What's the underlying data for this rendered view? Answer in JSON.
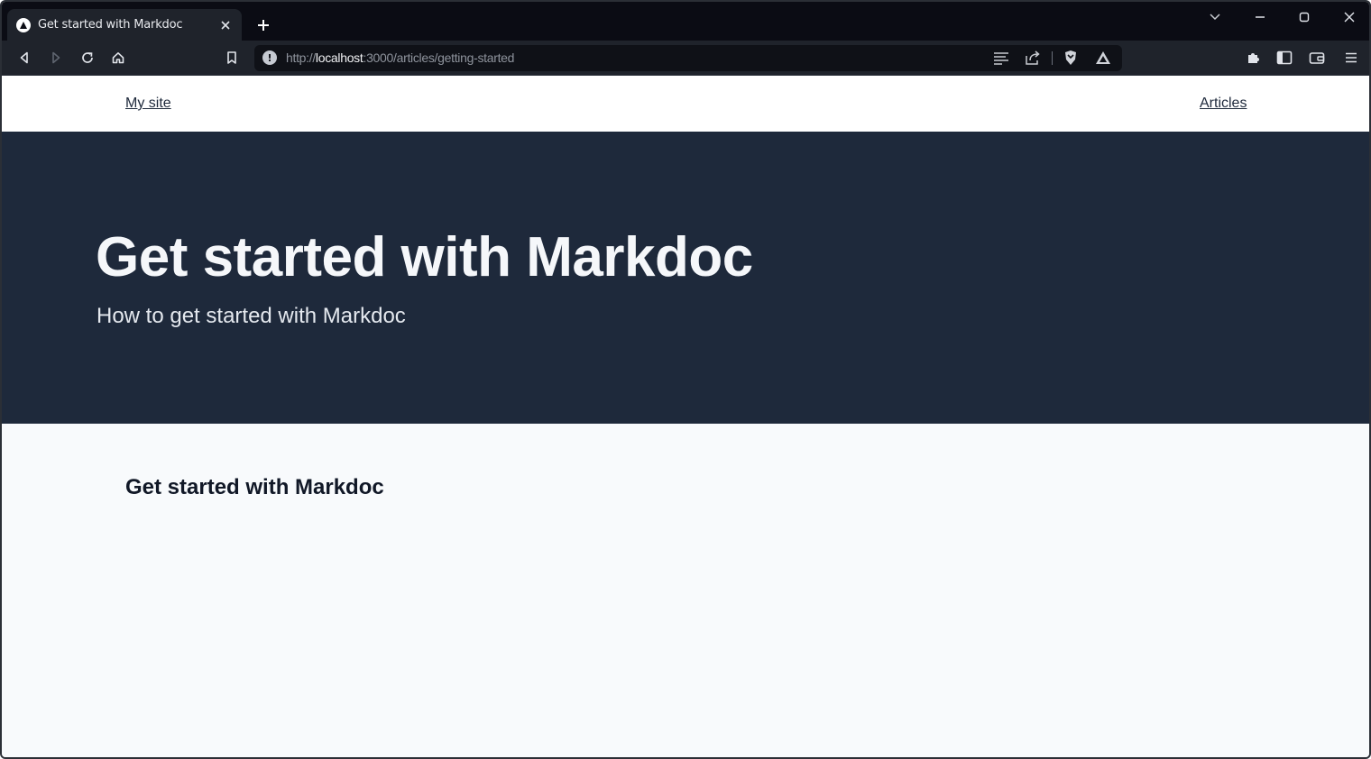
{
  "browser": {
    "tab": {
      "title": "Get started with Markdoc"
    },
    "address_bar": {
      "scheme": "http://",
      "host": "localhost",
      "path": ":3000/articles/getting-started"
    }
  },
  "site": {
    "nav": {
      "home_label": "My site",
      "articles_label": "Articles"
    },
    "hero": {
      "title": "Get started with Markdoc",
      "subtitle": "How to get started with Markdoc"
    },
    "content": {
      "heading": "Get started with Markdoc"
    }
  },
  "colors": {
    "tabstrip_bg": "#0b0c14",
    "toolbar_bg": "#1f232b",
    "hero_bg": "#1e293b",
    "page_bg": "#f8fafc"
  },
  "icons": {
    "tab_favicon": "triangle-icon",
    "tab_close": "close-icon",
    "new_tab": "plus-icon",
    "back": "back-arrow-icon",
    "forward": "forward-arrow-icon",
    "reload": "reload-icon",
    "home": "home-icon",
    "bookmark": "bookmark-icon",
    "site_info": "info-icon",
    "reader_mode": "reader-mode-icon",
    "share": "share-icon",
    "shields": "brave-shields-icon",
    "rewards": "brave-rewards-icon",
    "extensions": "puzzle-icon",
    "sidebar": "sidebar-icon",
    "wallet": "wallet-icon",
    "menu": "hamburger-menu-icon"
  }
}
